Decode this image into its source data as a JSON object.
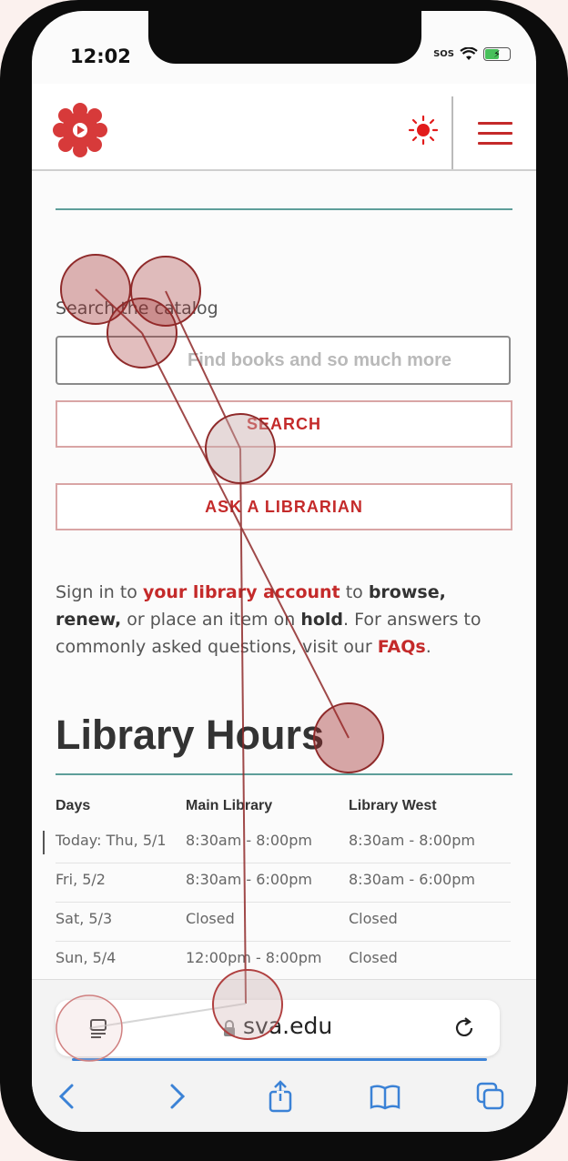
{
  "status": {
    "time": "12:02",
    "sos": "SOS"
  },
  "catalog": {
    "label": "Search the catalog",
    "placeholder": "Find books and so much more",
    "search_label": "SEARCH",
    "ask_label": "ASK A LIBRARIAN"
  },
  "intro": {
    "p1": "Sign in to ",
    "link_account": "your library account",
    "p2": " to ",
    "b_browse": "browse,",
    "b_renew": "renew,",
    "p3": " or place an item on ",
    "b_hold": "hold",
    "p4": ". For answers to commonly asked questions, visit our ",
    "link_faqs": "FAQs",
    "p5": "."
  },
  "hours": {
    "title": "Library Hours",
    "headers": [
      "Days",
      "Main Library",
      "Library West"
    ],
    "rows": [
      [
        "Today: Thu, 5/1",
        "8:30am - 8:00pm",
        "8:30am - 8:00pm"
      ],
      [
        "Fri, 5/2",
        "8:30am - 6:00pm",
        "8:30am - 6:00pm"
      ],
      [
        "Sat, 5/3",
        "Closed",
        "Closed"
      ],
      [
        "Sun, 5/4",
        "12:00pm - 8:00pm",
        "Closed"
      ]
    ]
  },
  "browser": {
    "url": "sva.edu",
    "page_load_progress": 1.0
  },
  "colors": {
    "brand_red": "#c42a2a",
    "teal": "#5e9e9a",
    "ios_blue": "#3b82d6"
  },
  "icons": [
    "logo-icon",
    "sun-icon",
    "hamburger-icon",
    "tabs-icon",
    "lock-icon",
    "reload-icon",
    "back-icon",
    "forward-icon",
    "share-icon",
    "bookmarks-icon",
    "tabs-overview-icon"
  ]
}
